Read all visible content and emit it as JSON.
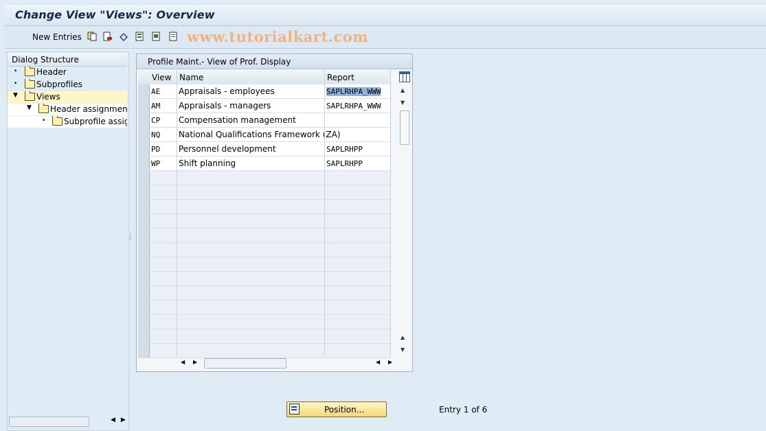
{
  "window": {
    "title": "Change View \"Views\": Overview"
  },
  "toolbar": {
    "new_entries": "New Entries",
    "icons": [
      "copy-icon",
      "delete-icon",
      "undo-icon",
      "select-all-icon",
      "select-block-icon",
      "deselect-all-icon"
    ],
    "watermark": "www.tutorialkart.com"
  },
  "dialog_structure": {
    "title": "Dialog Structure",
    "items": [
      {
        "label": "Header"
      },
      {
        "label": "Subprofiles"
      },
      {
        "label": "Views"
      },
      {
        "label": "Header assignment"
      },
      {
        "label": "Subprofile assignment"
      }
    ]
  },
  "table": {
    "caption": "Profile Maint.- View of Prof. Display",
    "columns": [
      "View",
      "Name",
      "Report"
    ],
    "rows": [
      {
        "view": "AE",
        "name": "Appraisals - employees",
        "report": "SAPLRHPA_WWW"
      },
      {
        "view": "AM",
        "name": "Appraisals - managers",
        "report": "SAPLRHPA_WWW"
      },
      {
        "view": "CP",
        "name": "Compensation management",
        "report": ""
      },
      {
        "view": "NQ",
        "name": "National Qualifications Framework (ZA)",
        "report": ""
      },
      {
        "view": "PD",
        "name": "Personnel development",
        "report": "SAPLRHPP"
      },
      {
        "view": "WP",
        "name": "Shift planning",
        "report": "SAPLRHPP"
      }
    ]
  },
  "footer": {
    "position_button": "Position...",
    "entry_info": "Entry 1 of 6"
  }
}
